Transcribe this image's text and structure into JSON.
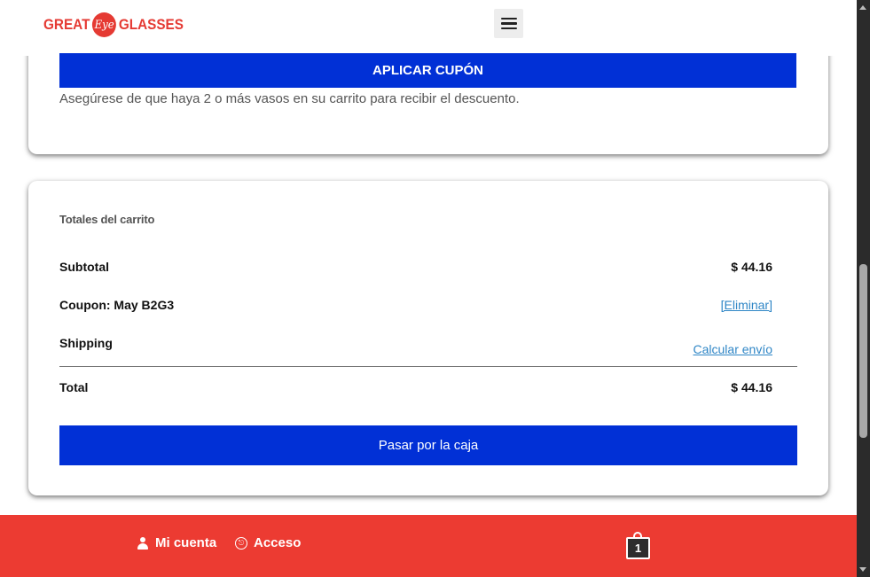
{
  "header": {
    "logo": {
      "left": "GREAT",
      "middle": "Eye",
      "right": "GLASSES"
    },
    "menu_icon": "hamburger-menu-icon"
  },
  "coupon": {
    "apply_label": "APLICAR CUPÓN",
    "note": "Asegúrese de que haya 2 o más vasos en su carrito para recibir el descuento."
  },
  "totals": {
    "title": "Totales del carrito",
    "subtotal_label": "Subtotal",
    "subtotal_value": "$ 44.16",
    "coupon_label": "Coupon: May B2G3",
    "coupon_action": "[Eliminar]",
    "shipping_label": "Shipping",
    "shipping_action": "Calcular envío",
    "total_label": "Total",
    "total_value": "$ 44.16",
    "checkout_label": "Pasar por la caja"
  },
  "footer": {
    "account_label": "Mi cuenta",
    "login_label": "Acceso",
    "login_icon_glyph": "⎋",
    "cart_count": "1"
  },
  "colors": {
    "brand_red": "#ec3b32",
    "button_blue": "#0130d6",
    "link_blue": "#2f86c6"
  }
}
